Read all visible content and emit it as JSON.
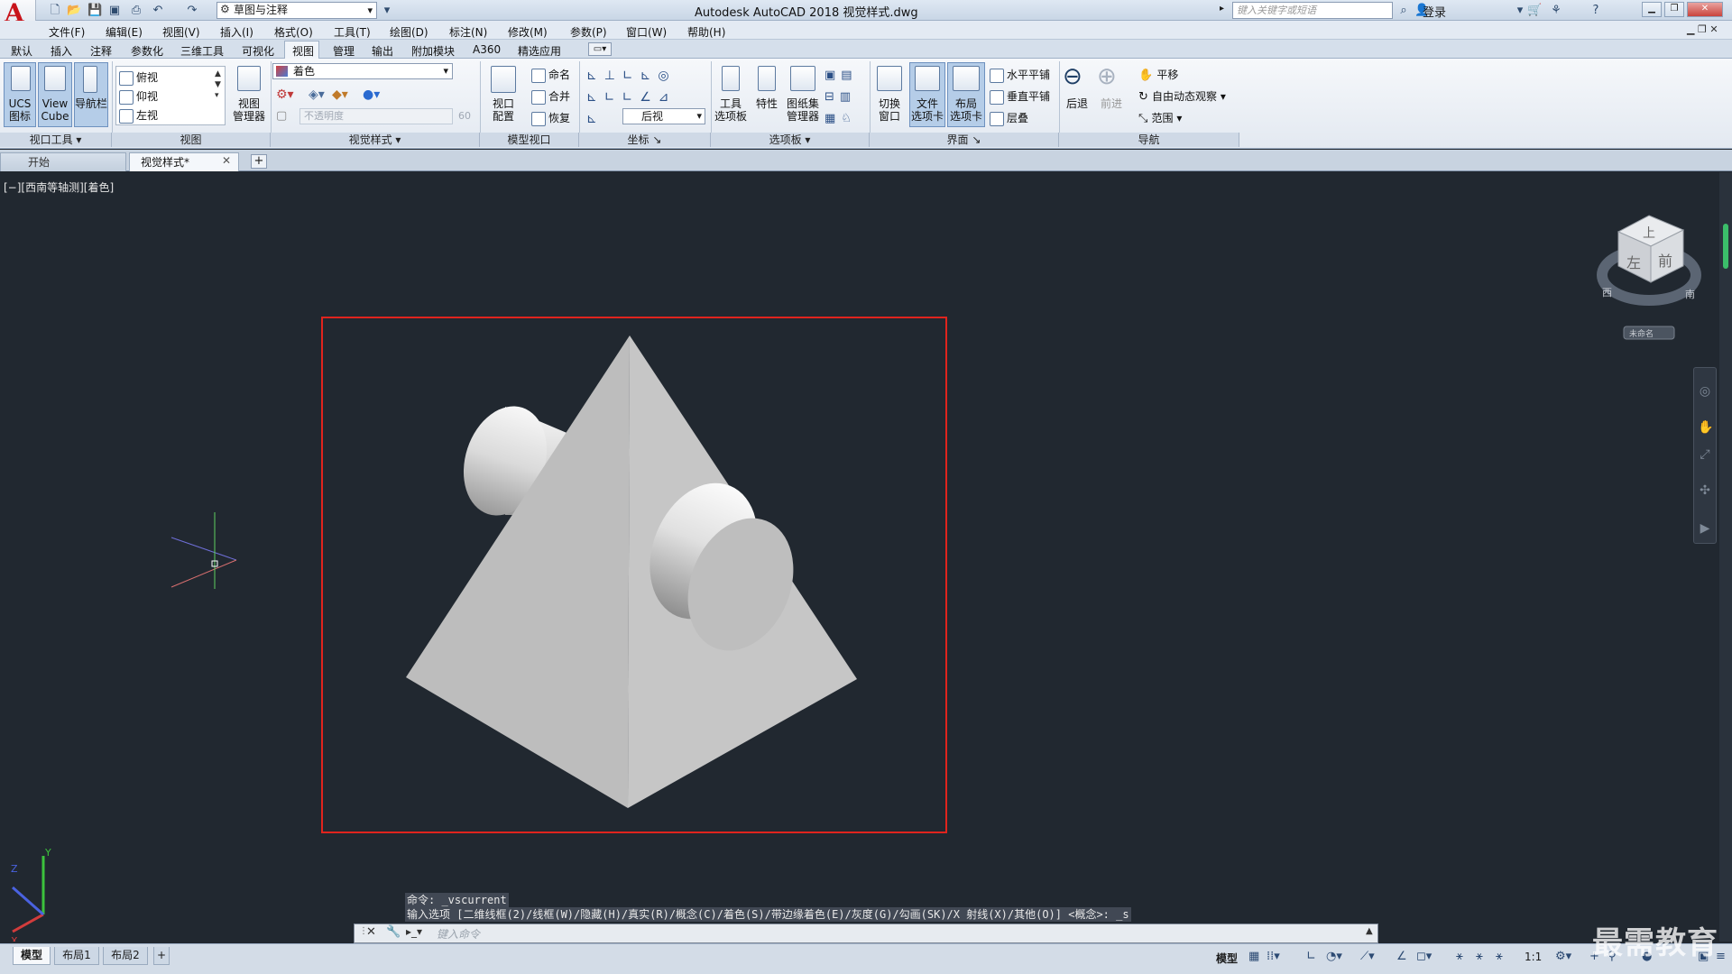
{
  "titlebar": {
    "workspace": "草图与注释",
    "title": "Autodesk AutoCAD 2018    视觉样式.dwg",
    "search_placeholder": "键入关键字或短语",
    "login": "登录"
  },
  "menu": [
    "文件(F)",
    "编辑(E)",
    "视图(V)",
    "插入(I)",
    "格式(O)",
    "工具(T)",
    "绘图(D)",
    "标注(N)",
    "修改(M)",
    "参数(P)",
    "窗口(W)",
    "帮助(H)"
  ],
  "ribbon_tabs": [
    "默认",
    "插入",
    "注释",
    "参数化",
    "三维工具",
    "可视化",
    "视图",
    "管理",
    "输出",
    "附加模块",
    "A360",
    "精选应用"
  ],
  "panels": {
    "viewport_tools": {
      "title": "视口工具",
      "ucs": "UCS\n图标",
      "viewcube": "View\nCube",
      "navbar": "导航栏"
    },
    "views": {
      "title": "视图",
      "items": [
        "俯视",
        "仰视",
        "左视"
      ],
      "manager": "视图\n管理器"
    },
    "visual_styles": {
      "title": "视觉样式",
      "current": "着色",
      "opacity_label": "不透明度",
      "opacity_value": "60"
    },
    "model_viewports": {
      "title": "模型视口",
      "config": "视口\n配置",
      "named": "命名",
      "join": "合并",
      "restore": "恢复"
    },
    "coordinates": {
      "title": "坐标",
      "current": "后视"
    },
    "palettes": {
      "title": "选项板",
      "tool": "工具\n选项板",
      "properties": "特性",
      "sheet": "图纸集\n管理器"
    },
    "interface": {
      "title": "界面",
      "switch": "切换\n窗口",
      "filetabs": "文件\n选项卡",
      "layouttabs": "布局\n选项卡",
      "tile_h": "水平平铺",
      "tile_v": "垂直平铺",
      "cascade": "层叠"
    },
    "navigate": {
      "title": "导航",
      "back": "后退",
      "forward": "前进",
      "pan": "平移",
      "orbit": "自由动态观察",
      "extents": "范围"
    }
  },
  "filetabs": {
    "start": "开始",
    "doc": "视觉样式*"
  },
  "viewport": {
    "label": "[−][西南等轴测][着色]",
    "viewcube_top": "上",
    "viewcube_front": "前",
    "viewcube_left": "左",
    "compass_w": "西",
    "compass_s": "南",
    "ucs_name": "未命名"
  },
  "cmd": {
    "line1": "命令: _vscurrent",
    "line2": "输入选项 [二维线框(2)/线框(W)/隐藏(H)/真实(R)/概念(C)/着色(S)/带边缘着色(E)/灰度(G)/勾画(SK)/X 射线(X)/其他(O)] <概念>: _s",
    "placeholder": "键入命令"
  },
  "layout_tabs": [
    "模型",
    "布局1",
    "布局2"
  ],
  "status": {
    "model": "模型",
    "scale": "1:1"
  },
  "watermark": "最需教育",
  "colors": {
    "selection": "#e0241d",
    "background": "#212830"
  }
}
